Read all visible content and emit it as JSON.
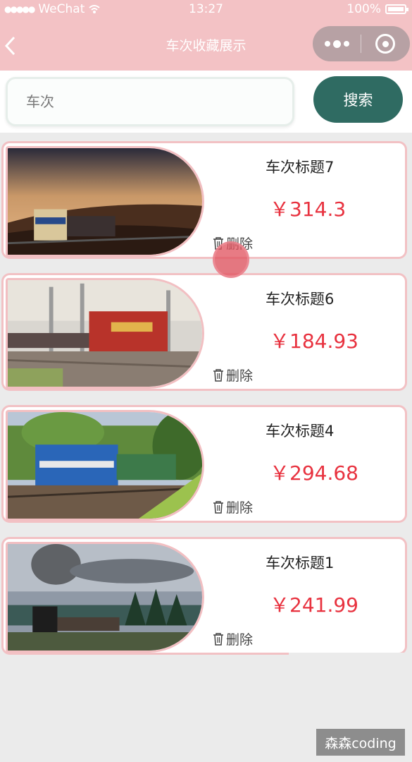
{
  "status_bar": {
    "carrier": "WeChat",
    "time": "13:27",
    "battery": "100%"
  },
  "nav": {
    "back_icon": "chevron-left-icon",
    "title": "车次收藏展示",
    "menu_icon": "more-dots-icon",
    "close_icon": "target-circle-icon"
  },
  "search": {
    "placeholder": "车次",
    "button_label": "搜索"
  },
  "cards": [
    {
      "title": "车次标题7",
      "price": "￥314.3",
      "delete_label": "删除",
      "scene": "desert sunset locomotive"
    },
    {
      "title": "车次标题6",
      "price": "￥184.93",
      "delete_label": "删除",
      "scene": "red freight locomotive"
    },
    {
      "title": "车次标题4",
      "price": "￥294.68",
      "delete_label": "删除",
      "scene": "blue electric locomotive"
    },
    {
      "title": "车次标题1",
      "price": "￥241.99",
      "delete_label": "删除",
      "scene": "steam locomotive smoke"
    }
  ],
  "watermark": "森森coding",
  "colors": {
    "nav_bg": "#f3c2c5",
    "accent_button": "#2f6b62",
    "price": "#e8323f",
    "card_border": "#f2c1c4",
    "page_bg": "#ebebeb"
  }
}
